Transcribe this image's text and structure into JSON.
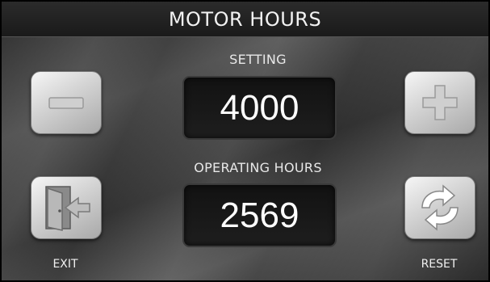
{
  "header": {
    "title": "MOTOR HOURS"
  },
  "setting": {
    "label": "SETTING",
    "value": "4000"
  },
  "operating": {
    "label": "OPERATING HOURS",
    "value": "2569"
  },
  "buttons": {
    "minus_icon": "minus-icon",
    "plus_icon": "plus-icon",
    "exit_label": "EXIT",
    "exit_icon": "exit-door-icon",
    "reset_label": "RESET",
    "reset_icon": "refresh-arrows-icon"
  },
  "colors": {
    "background": "#3a3a3a",
    "display_bg": "#161616",
    "button": "#d0d0d0",
    "text": "#ffffff"
  }
}
